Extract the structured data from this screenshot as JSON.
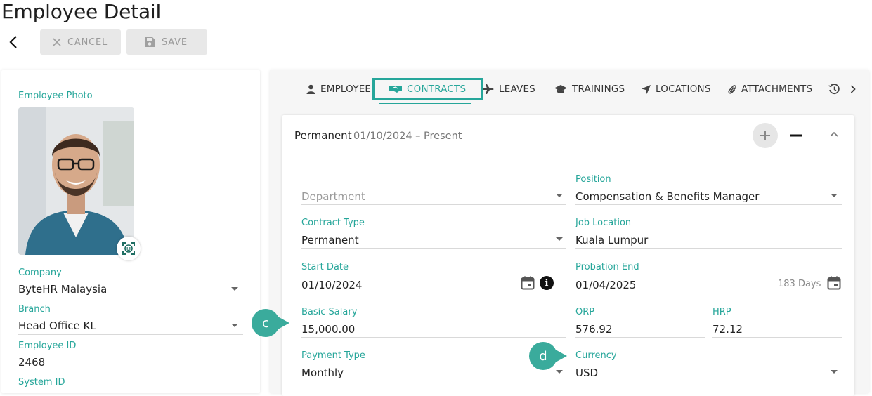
{
  "page": {
    "title": "Employee Detail"
  },
  "toolbar": {
    "cancel_label": "CANCEL",
    "save_label": "SAVE"
  },
  "left_panel": {
    "photo_label": "Employee Photo",
    "company": {
      "label": "Company",
      "value": "ByteHR Malaysia"
    },
    "branch": {
      "label": "Branch",
      "value": "Head Office KL"
    },
    "employee_id": {
      "label": "Employee ID",
      "value": "2468"
    },
    "system_id": {
      "label": "System ID"
    }
  },
  "tabs": [
    {
      "label": "EMPLOYEE",
      "icon": "person-icon"
    },
    {
      "label": "CONTRACTS",
      "icon": "handshake-icon",
      "active": true
    },
    {
      "label": "LEAVES",
      "icon": "plane-icon"
    },
    {
      "label": "TRAININGS",
      "icon": "graduation-cap-icon"
    },
    {
      "label": "LOCATIONS",
      "icon": "location-arrow-icon"
    },
    {
      "label": "ATTACHMENTS",
      "icon": "paperclip-icon"
    }
  ],
  "contract": {
    "type": "Permanent",
    "period": "01/10/2024 – Present",
    "fields": {
      "department": {
        "placeholder": "Department"
      },
      "position": {
        "label": "Position",
        "value": "Compensation & Benefits Manager"
      },
      "contract_type": {
        "label": "Contract Type",
        "value": "Permanent"
      },
      "job_location": {
        "label": "Job Location",
        "value": "Kuala Lumpur"
      },
      "start_date": {
        "label": "Start Date",
        "value": "01/10/2024"
      },
      "probation_end": {
        "label": "Probation End",
        "value": "01/04/2025",
        "days": "183 Days"
      },
      "basic_salary": {
        "label": "Basic Salary",
        "value": "15,000.00"
      },
      "orp": {
        "label": "ORP",
        "value": "576.92"
      },
      "hrp": {
        "label": "HRP",
        "value": "72.12"
      },
      "payment_type": {
        "label": "Payment Type",
        "value": "Monthly"
      },
      "currency": {
        "label": "Currency",
        "value": "USD"
      }
    }
  },
  "callouts": {
    "c": "c",
    "d": "d"
  },
  "colors": {
    "accent": "#26a69a",
    "callout": "#3aab9c"
  }
}
